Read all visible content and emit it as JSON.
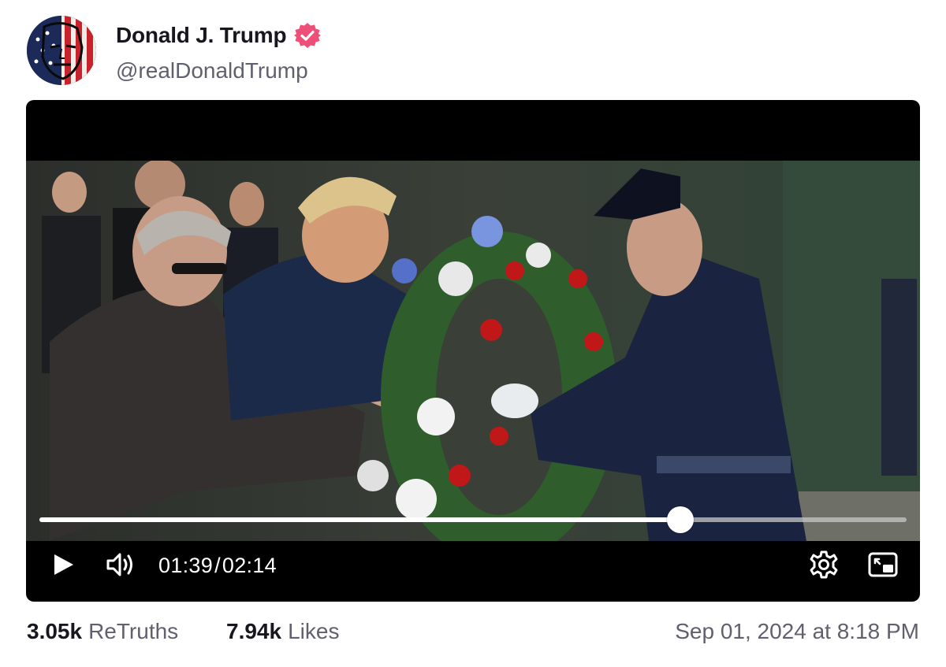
{
  "post": {
    "author": {
      "display_name": "Donald J. Trump",
      "handle": "@realDonaldTrump",
      "verified_icon": "verified-badge-icon",
      "verified_color": "#ee4f79"
    },
    "video": {
      "current_time": "01:39",
      "separator": "/",
      "duration": "02:14",
      "progress": 0.739,
      "icons": {
        "play": "play-icon",
        "volume": "volume-icon",
        "settings": "gear-icon",
        "pip": "picture-in-picture-icon"
      }
    },
    "stats": {
      "retruths_count": "3.05k",
      "retruths_label": "ReTruths",
      "likes_count": "7.94k",
      "likes_label": "Likes"
    },
    "timestamp": "Sep 01, 2024 at 8:18 PM"
  },
  "colors": {
    "text_primary": "#17171f",
    "text_secondary": "#60606e",
    "video_bg": "#000000"
  }
}
